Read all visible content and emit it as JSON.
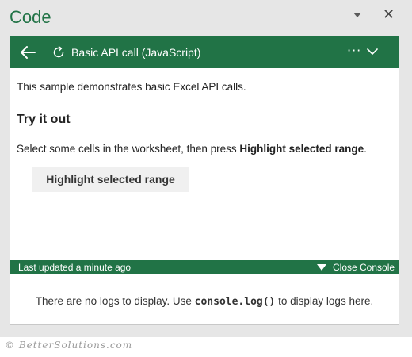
{
  "pane": {
    "title": "Code",
    "dropdown_icon": "caret-down-icon",
    "close_icon": "close-icon",
    "close_glyph": "✕"
  },
  "header": {
    "back_icon": "arrow-left-icon",
    "refresh_icon": "refresh-icon",
    "title": "Basic API call (JavaScript)",
    "more_icon": "ellipsis-icon",
    "more_glyph": "···",
    "chevron_icon": "chevron-down-icon"
  },
  "content": {
    "description": "This sample demonstrates basic Excel API calls.",
    "heading": "Try it out",
    "instruction_prefix": "Select some cells in the worksheet, then press ",
    "instruction_bold": "Highlight selected range",
    "instruction_suffix": ".",
    "button_label": "Highlight selected range"
  },
  "status_bar": {
    "updated_text": "Last updated a minute ago",
    "close_console_label": "Close Console",
    "close_console_icon": "triangle-down-icon"
  },
  "console": {
    "msg_prefix": "There are no logs to display. Use ",
    "msg_code": "console.log()",
    "msg_suffix": " to display logs here."
  },
  "watermark": "© BetterSolutions.com",
  "colors": {
    "accent": "#217346",
    "pane_background": "#e6e6e6",
    "button_background": "#f0f0f0"
  }
}
